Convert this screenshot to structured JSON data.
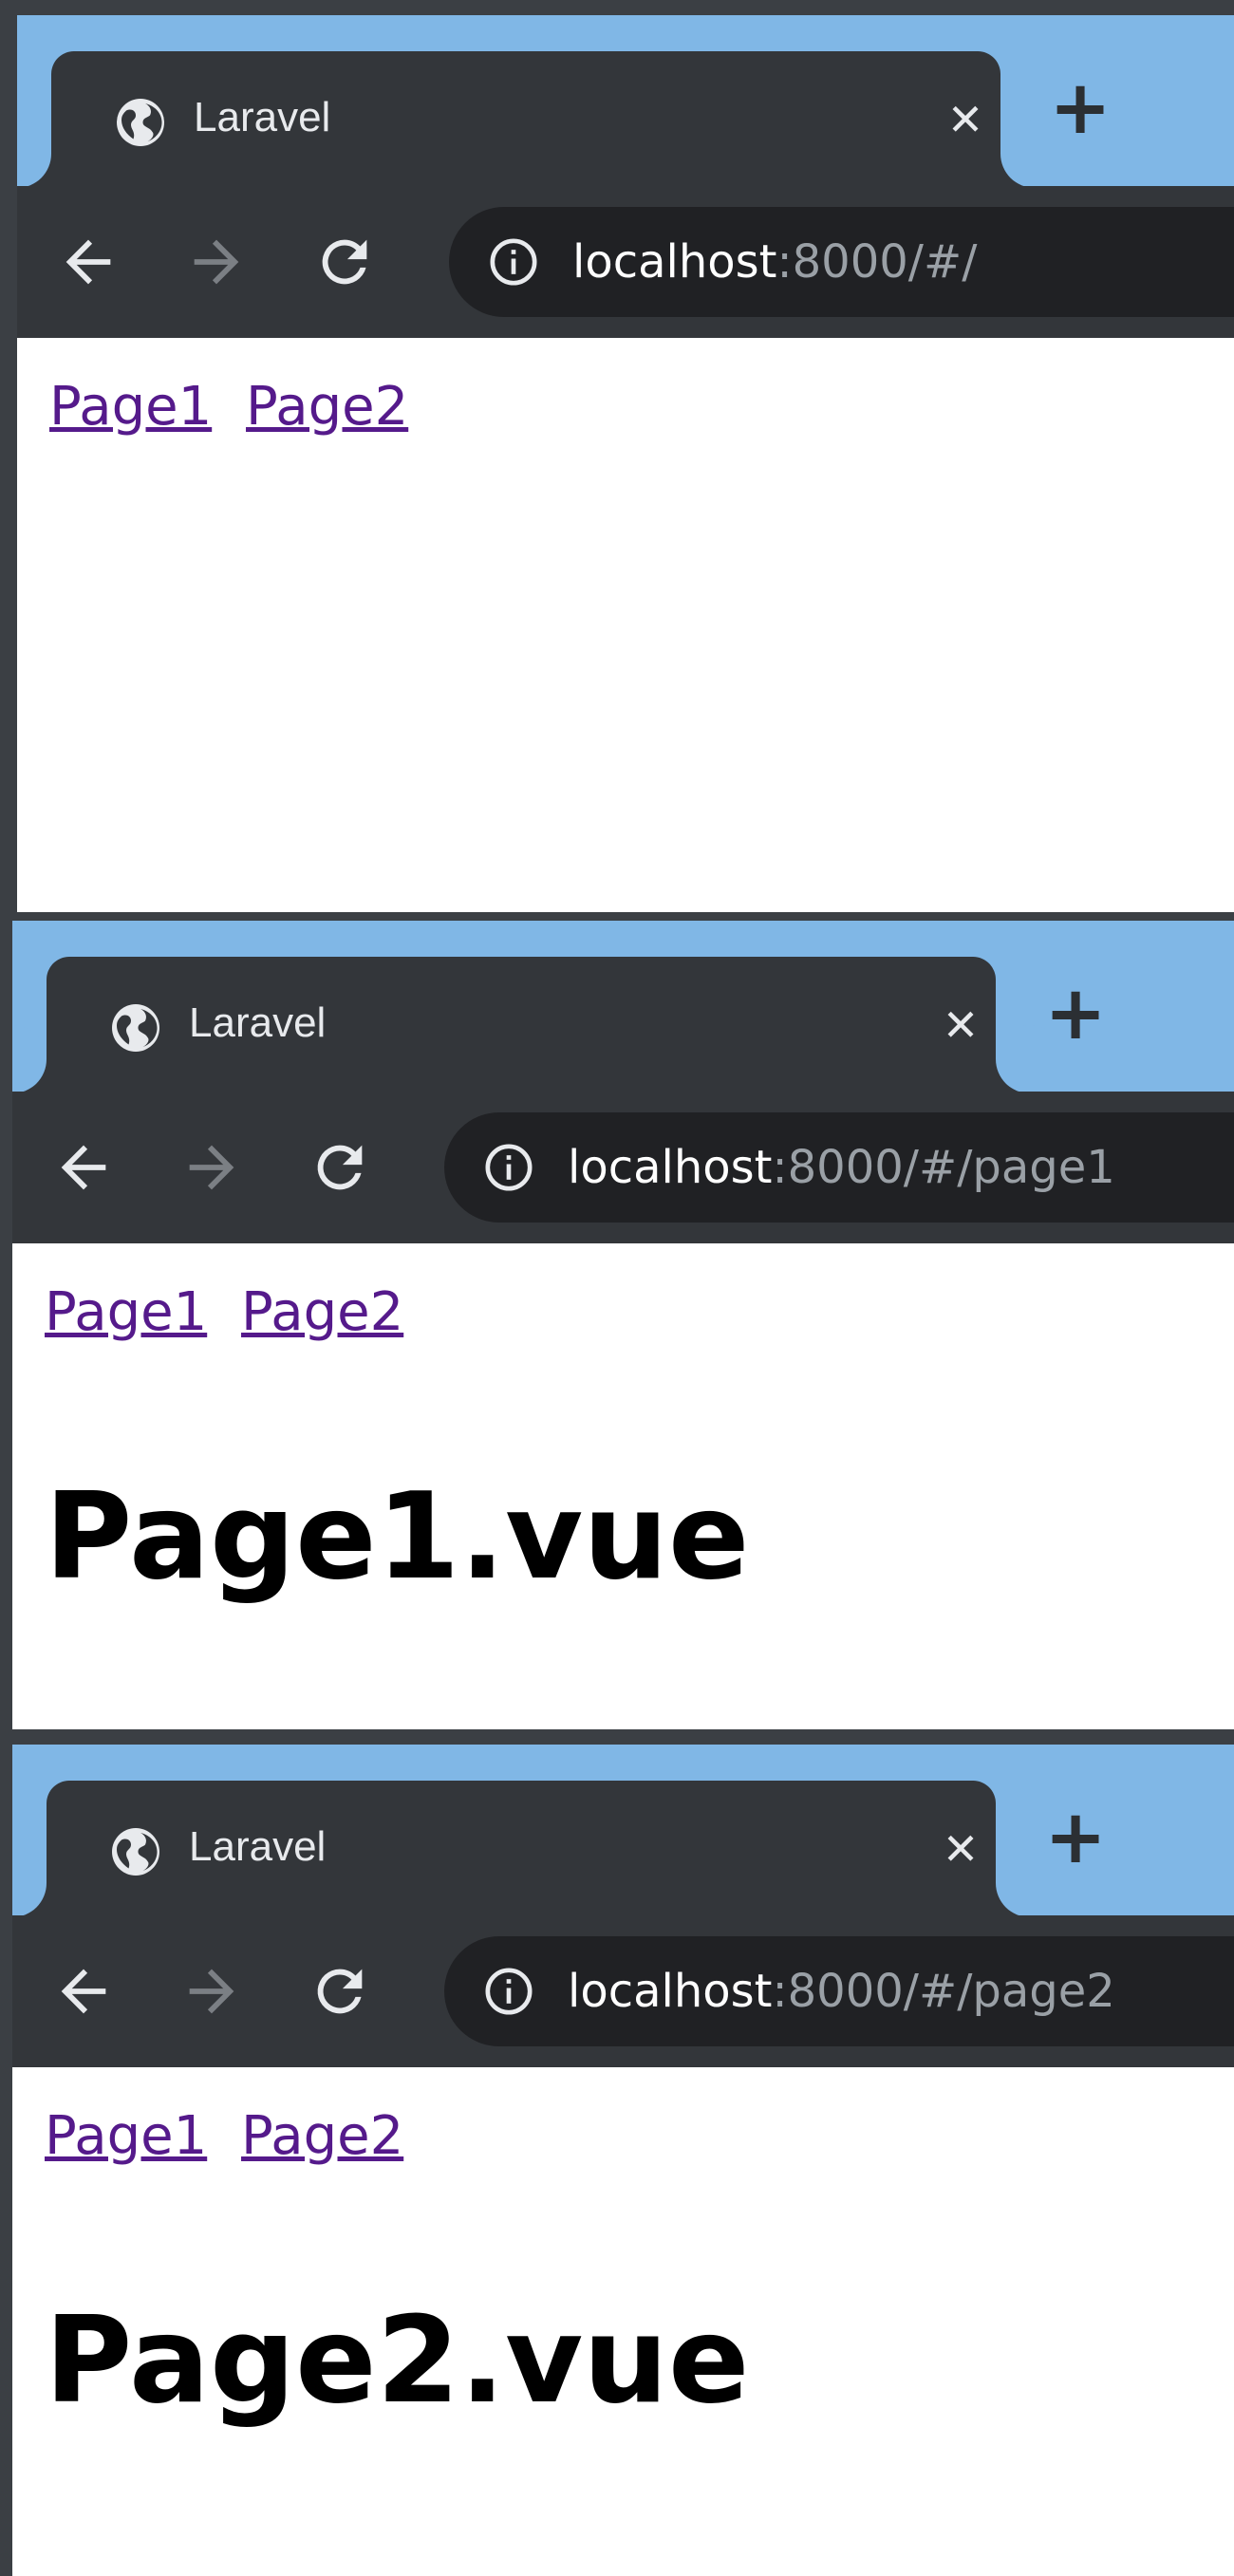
{
  "windows": [
    {
      "tab": {
        "title": "Laravel",
        "close_symbol": "✕",
        "new_tab_symbol": "+"
      },
      "address": {
        "host": "localhost",
        "rest": ":8000/#/"
      },
      "links": [
        "Page1",
        "Page2"
      ],
      "heading": ""
    },
    {
      "tab": {
        "title": "Laravel",
        "close_symbol": "✕",
        "new_tab_symbol": "+"
      },
      "address": {
        "host": "localhost",
        "rest": ":8000/#/page1"
      },
      "links": [
        "Page1",
        "Page2"
      ],
      "heading": "Page1.vue"
    },
    {
      "tab": {
        "title": "Laravel",
        "close_symbol": "✕",
        "new_tab_symbol": "+"
      },
      "address": {
        "host": "localhost",
        "rest": ":8000/#/page2"
      },
      "links": [
        "Page1",
        "Page2"
      ],
      "heading": "Page2.vue"
    }
  ],
  "colors": {
    "tabstrip": "#80b7e6",
    "chrome": "#33363a",
    "omnibox": "#202124",
    "visited_link": "#551a8b"
  },
  "icons": [
    "globe-icon",
    "info-icon",
    "back-arrow-icon",
    "forward-arrow-icon",
    "reload-icon",
    "close-icon",
    "plus-icon"
  ]
}
